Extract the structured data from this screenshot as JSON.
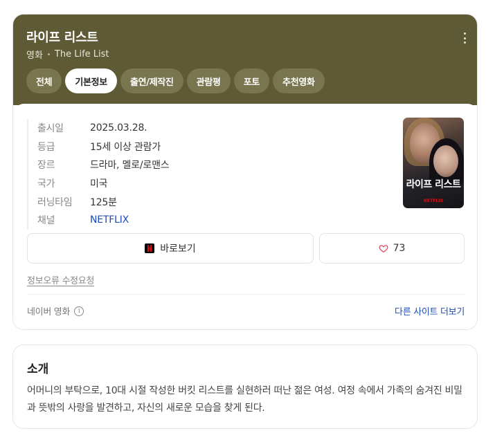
{
  "header": {
    "title": "라이프 리스트",
    "type": "영화",
    "original_title": "The Life List"
  },
  "tabs": [
    {
      "label": "전체",
      "active": false
    },
    {
      "label": "기본정보",
      "active": true
    },
    {
      "label": "출연/제작진",
      "active": false
    },
    {
      "label": "관람평",
      "active": false
    },
    {
      "label": "포토",
      "active": false
    },
    {
      "label": "추천영화",
      "active": false
    }
  ],
  "info": [
    {
      "key": "출시일",
      "value": "2025.03.28."
    },
    {
      "key": "등급",
      "value": "15세 이상 관람가"
    },
    {
      "key": "장르",
      "value": "드라마, 멜로/로맨스"
    },
    {
      "key": "국가",
      "value": "미국"
    },
    {
      "key": "러닝타임",
      "value": "125분"
    },
    {
      "key": "채널",
      "value": "NETFLIX"
    }
  ],
  "poster": {
    "title": "라이프 리스트",
    "brand": "NETFLIX"
  },
  "actions": {
    "watch_label": "바로보기",
    "like_count": "73"
  },
  "report_label": "정보오류 수정요청",
  "source_label": "네이버 영화",
  "more_sites_label": "다른 사이트 더보기",
  "intro": {
    "title": "소개",
    "text": "어머니의 부탁으로, 10대 시절 작성한 버킷 리스트를 실현하러 떠난 젊은 여성. 여정 속에서 가족의 숨겨진 비밀과 뜻밖의 사랑을 발견하고, 자신의 새로운 모습을 찾게 된다."
  },
  "colors": {
    "header_bg": "#5e5a36",
    "tab_bg": "#79754f",
    "link": "#1c4bb8",
    "netflix_red": "#e50914"
  }
}
